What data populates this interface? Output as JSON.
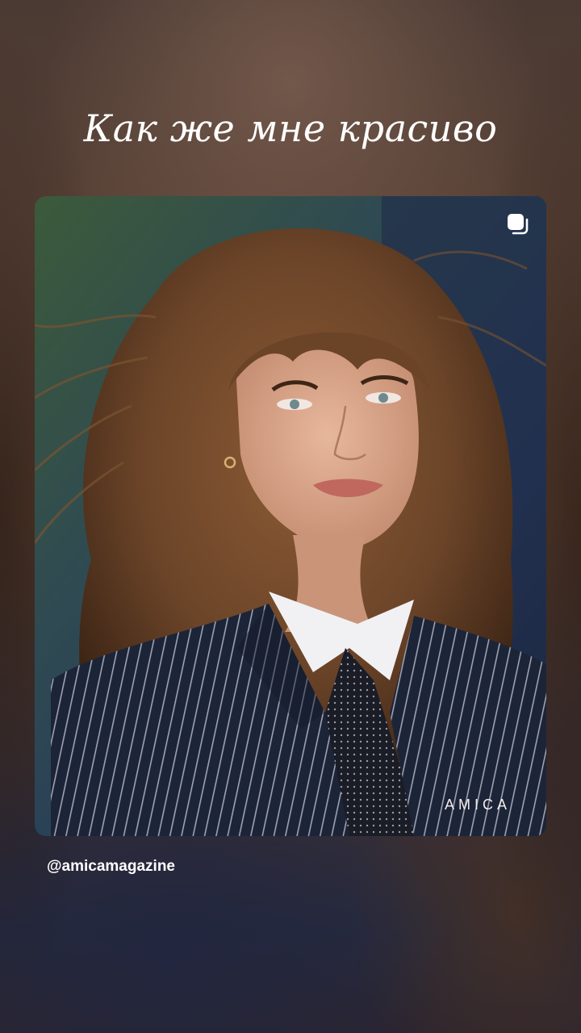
{
  "story": {
    "caption": "Как же мне красиво"
  },
  "post": {
    "watermark": "AMICA",
    "icon": "multiple-posts-icon",
    "handle": "@amicamagazine"
  },
  "colors": {
    "jacket": "#1c2438",
    "hair": "#6b4428",
    "skin": "#d9a58a",
    "background_green": "#3c5a3a"
  }
}
